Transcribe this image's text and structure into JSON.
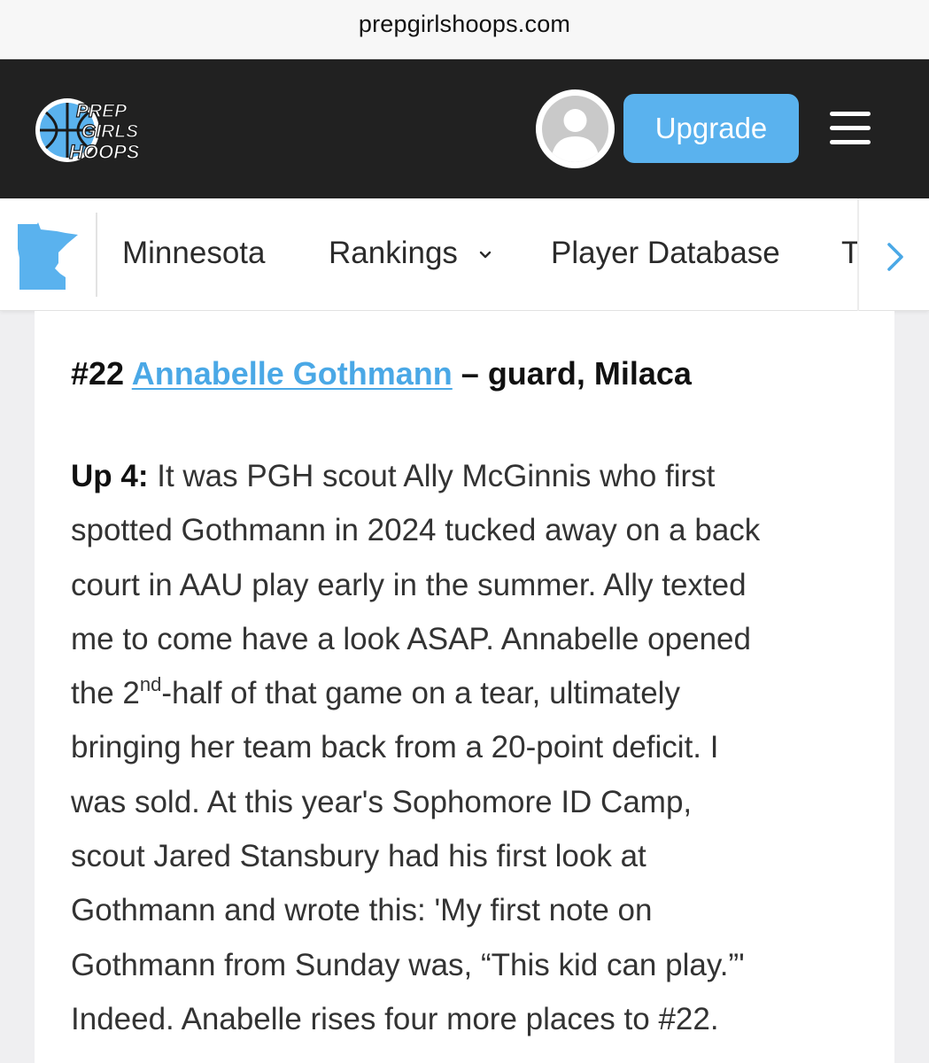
{
  "browser": {
    "url": "prepgirlshoops.com"
  },
  "header": {
    "logo_text": [
      "PREP",
      "GIRLS",
      "HOOPS"
    ],
    "upgrade_label": "Upgrade",
    "brand_blue": "#5ab2ee",
    "background": "#212121"
  },
  "subnav": {
    "state_icon": "minnesota-map-icon",
    "items": [
      {
        "label": "Minnesota"
      },
      {
        "label": "Rankings"
      },
      {
        "label": "Player Database"
      },
      {
        "label": "T"
      }
    ]
  },
  "article": {
    "heading": {
      "rank": "#22",
      "player_name": "Annabelle Gothmann",
      "rest": "– guard, Milaca"
    },
    "body": {
      "label": "Up 4:",
      "line1": "It was PGH scout Ally McGinnis who first",
      "line2": "spotted Gothmann in 2024 tucked away on a back",
      "line3": "court in AAU play early in the summer. Ally texted",
      "line4": "me to come have a look ASAP. Annabelle opened",
      "line5a": "the 2",
      "line5sup": "nd",
      "line5b": "-half of that game on a tear, ultimately",
      "line6": "bringing her team back from a 20-point deficit. I",
      "line7": "was sold. At this year's Sophomore ID Camp,",
      "line8": "scout Jared Stansbury had his first look at",
      "line9": "Gothmann and wrote this: 'My first note on",
      "line10": "Gothmann from Sunday was, “This kid can play.”'",
      "line11": "Indeed. Anabelle rises four more places to #22."
    }
  }
}
